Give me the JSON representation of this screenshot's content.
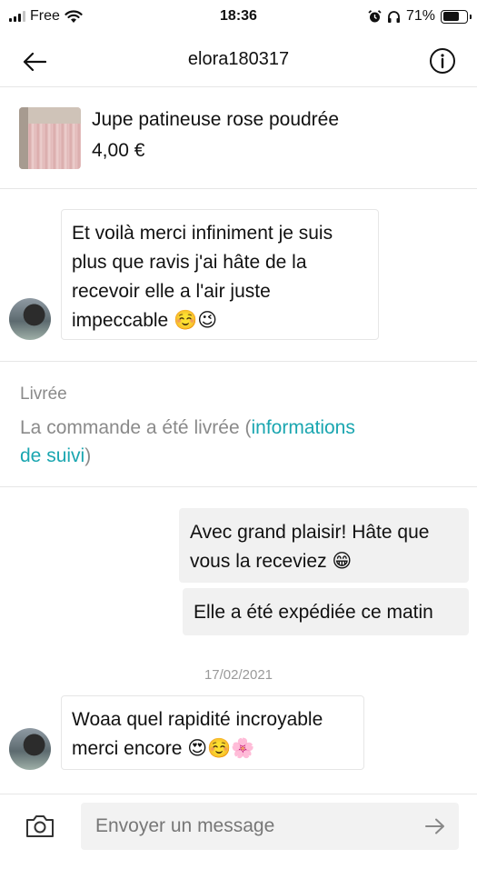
{
  "status_bar": {
    "carrier": "Free",
    "time": "18:36",
    "battery_pct": "71%",
    "battery_level": 0.71,
    "icons": [
      "signal-icon",
      "wifi-icon",
      "alarm-icon",
      "headphones-icon",
      "battery-icon"
    ]
  },
  "header": {
    "title": "elora180317",
    "back_icon": "arrow-left-icon",
    "info_icon": "info-icon"
  },
  "product": {
    "title": "Jupe patineuse rose poudrée",
    "price": "4,00 €"
  },
  "messages": [
    {
      "direction": "incoming",
      "lines": [
        "Et voilà merci infiniment je suis",
        "plus que ravis j'ai hâte de la",
        "recevoir elle a l'air juste",
        "impeccable ☺️😉"
      ]
    },
    {
      "direction": "outgoing",
      "lines": [
        "Avec grand plaisir! Hâte que",
        "vous la receviez 😁"
      ]
    },
    {
      "direction": "outgoing",
      "lines": [
        "Elle a été expédiée ce matin"
      ]
    },
    {
      "direction": "incoming",
      "lines": [
        "Woaa quel rapidité incroyable",
        "merci encore 😍☺️🌸"
      ]
    }
  ],
  "order_status": {
    "title": "Livrée",
    "text_before": "La commande a été livrée (",
    "link_line1": "informations",
    "link_line2": "de suivi",
    "text_after": ")"
  },
  "date_separator": "17/02/2021",
  "composer": {
    "placeholder": "Envoyer un message",
    "camera_icon": "camera-icon",
    "send_icon": "arrow-right-icon"
  },
  "colors": {
    "accent_link": "#1aa6b0",
    "muted_text": "#8a8a8a",
    "outgoing_bubble": "#f1f1f1"
  }
}
